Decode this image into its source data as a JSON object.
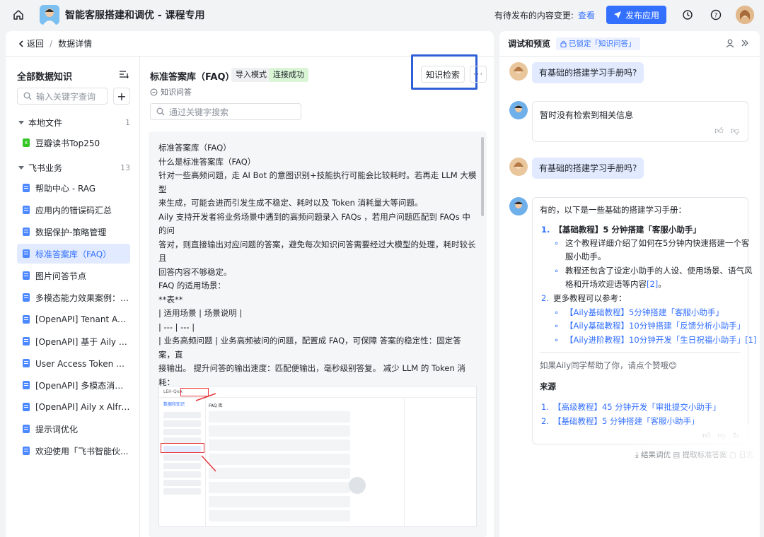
{
  "app": {
    "title": "智能客服搭建和调优 - 课程专用",
    "pending_text": "有待发布的内容变更:",
    "pending_link": "查看",
    "publish_label": "发布应用"
  },
  "breadcrumb": {
    "back": "返回",
    "separator": "/",
    "current": "数据详情"
  },
  "sidebar": {
    "title": "全部数据知识",
    "search_placeholder": "输入关键字查询",
    "add_label": "+",
    "groups": [
      {
        "label": "本地文件",
        "count": "1"
      },
      {
        "label": "飞书业务",
        "count": "13"
      }
    ],
    "local_items": [
      {
        "label": "豆瓣读书Top250",
        "type": "xls"
      }
    ],
    "feishu_items": [
      {
        "label": "帮助中心 - RAG"
      },
      {
        "label": "应用内的错误码汇总"
      },
      {
        "label": "数据保护-策略管理"
      },
      {
        "label": "标准答案库（FAQ）"
      },
      {
        "label": "图片问答节点"
      },
      {
        "label": "多模态能力效果案例：O..."
      },
      {
        "label": "[OpenAPI] Tenant Acce..."
      },
      {
        "label": "[OpenAPI] 基于 Aily 对..."
      },
      {
        "label": "User Access Token 简..."
      },
      {
        "label": "[OpenAPI] 多模态消息 ..."
      },
      {
        "label": "[OpenAPI] Aily x Alfred ..."
      },
      {
        "label": "提示词优化"
      },
      {
        "label": "欢迎使用「飞书智能伙..."
      }
    ]
  },
  "detail": {
    "title": "标准答案库（FAQ）",
    "tag_mode": "导入模式",
    "tag_status": "连接成功",
    "subtitle": "知识问答",
    "search_placeholder": "通过关键字搜索",
    "kb_button": "知识检索",
    "more_label": "···",
    "body": "标准答案库（FAQ）\n什么是标准答案库（FAQ）\n针对一些高频问题，走 AI Bot 的意图识别+技能执行可能会比较耗时。若再走 LLM 大模型\n来生成，可能会进而引发生成不稳定、耗时以及 Token 消耗量大等问题。\nAily 支持开发者将业务场景中遇到的高频问题录入 FAQs ，若用户问题匹配到 FAQs 中的问\n答对，则直接输出对应问题的答案，避免每次知识问答需要经过大模型的处理，耗时较长且\n回答内容不够稳定。\nFAQ 的适用场景：\n**表**\n| 适用场景 | 场景说明 |\n| --- | --- |\n| 业务高频问题 | 业务高频被问的问题，配置成 FAQ，可保障 答案的稳定性：固定答案，直\n接输出。 提升问答的输出速度：匹配便输出，毫秒级别答复。 减少 LLM 的 Token 消耗：\n不用过 LLM 生成。 |\n| 明确要拦截的问题 | 例如，你的 AI Bot 不支持人工服务，就配置一个问题为“人工服务”的\nFAQ 来做拦截。 |\n\n如何配置 FAQ\n功能入口\n在 Aily AI Bot 的“数据与预览”页面中，提供“FAQ 库”入口。",
    "screenshot_app": "LEH-QnA",
    "screenshot_tab": "数据和知识",
    "screenshot_faq": "FAQ 库"
  },
  "preview": {
    "title": "调试和预览",
    "lock_tag": "已锁定「知识问答」",
    "messages": [
      {
        "role": "user",
        "text": "有基础的搭建学习手册吗?"
      },
      {
        "role": "bot",
        "text": "暂时没有检索到相关信息"
      },
      {
        "role": "user",
        "text": "有基础的搭建学习手册吗?"
      }
    ],
    "answer": {
      "intro": "有的，以下是一些基础的搭建学习手册：",
      "l1_num": "1.",
      "l1_title": "【基础教程】5 分钟搭建「客服小助手」",
      "l1_b1a": "这个教程详细介绍了如何在5分钟内快速搭建一个客",
      "l1_b1b": "服小助手。",
      "l1_b2a": "教程还包含了设定小助手的人设、使用场景、语气风",
      "l1_b2b": "格和开场欢迎语等内容",
      "l1_ref": "[2]",
      "l1_b2c": "。",
      "l2_num": "2.",
      "l2_title": "更多教程可以参考：",
      "link1": "【Aily基础教程】5分钟搭建「客服小助手」",
      "link2": "【Aily基础教程】10分钟搭建「反馈分析小助手」",
      "link3": "【Aily进阶教程】10分钟开发「生日祝福小助手」[1]",
      "like_prompt": "如果Aily同学帮助了你，请点个赞哦😊",
      "source_title": "来源",
      "src1_num": "1.",
      "src1": "【高级教程】45 分钟开发「审批提交小助手」",
      "src2_num": "2.",
      "src2": "【基础教程】5 分钟搭建「客服小助手」"
    },
    "footer": "⤓ 结果调优   ▤ 提取标准答案   ▢ 日志"
  }
}
